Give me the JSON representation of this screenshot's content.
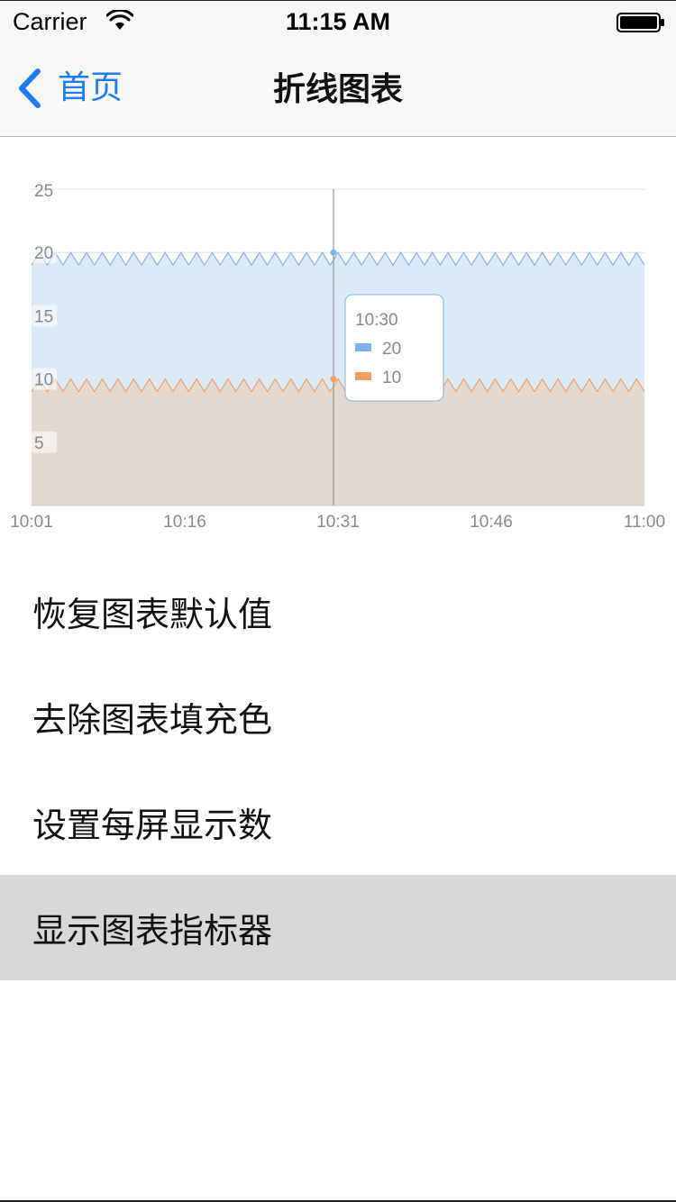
{
  "status_bar": {
    "carrier": "Carrier",
    "time": "11:15 AM",
    "wifi_icon": "wifi-icon",
    "battery_icon": "battery-icon"
  },
  "nav": {
    "back_label": "首页",
    "back_icon": "chevron-left-icon",
    "title": "折线图表"
  },
  "colors": {
    "accent": "#1d7cf2",
    "series_blue": "#7fb2ea",
    "series_orange": "#f0a062",
    "fill_blue": "#dce9f7",
    "fill_orange": "#e2d9d1"
  },
  "chart_data": {
    "type": "line",
    "x_ticks": [
      "10:01",
      "10:16",
      "10:31",
      "10:46",
      "11:00"
    ],
    "ylim": [
      0,
      25
    ],
    "y_ticks": [
      5,
      10,
      15,
      20,
      25
    ],
    "grid": true,
    "series": [
      {
        "color": "#7fb2ea",
        "fill": "#dce9f7",
        "low": 19,
        "high": 20,
        "zigzag_count": 39
      },
      {
        "color": "#f0a062",
        "fill": "#e2d9d1",
        "low": 9,
        "high": 10,
        "zigzag_count": 39
      }
    ],
    "indicator": {
      "x_label": "10:30",
      "values": [
        "20",
        "10"
      ],
      "colors": [
        "#7fb2ea",
        "#f0a062"
      ]
    }
  },
  "menu": {
    "items": [
      {
        "label": "恢复图表默认值",
        "selected": false
      },
      {
        "label": "去除图表填充色",
        "selected": false
      },
      {
        "label": "设置每屏显示数",
        "selected": false
      },
      {
        "label": "显示图表指标器",
        "selected": true
      }
    ]
  }
}
